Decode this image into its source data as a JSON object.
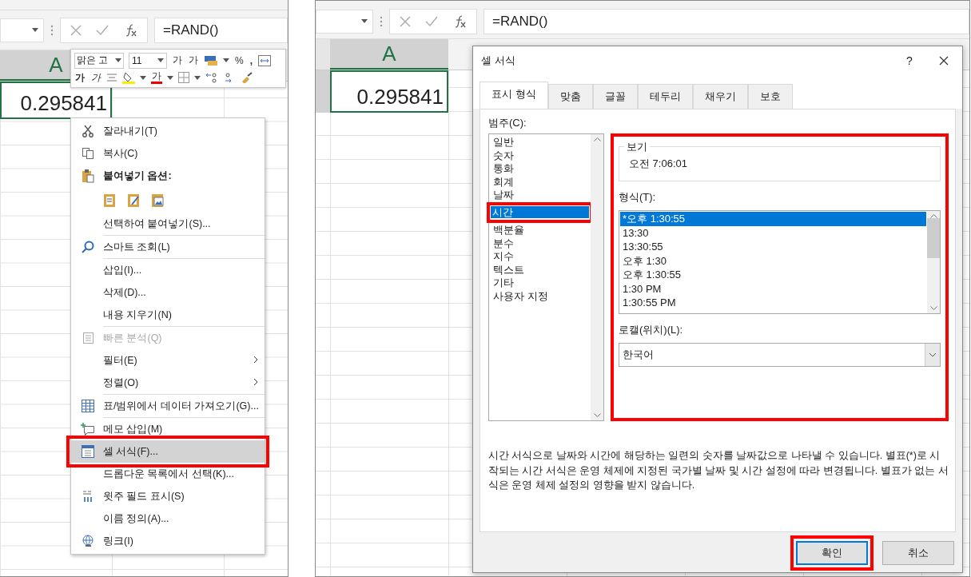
{
  "left": {
    "formula": "=RAND()",
    "column_header": "A",
    "cell_value": "0.295841",
    "mini_toolbar": {
      "font": "맑은 고",
      "size": "11",
      "grow_label": "가",
      "shrink_label": "가",
      "percent": "%",
      "comma": ",",
      "bold_label": "가",
      "italic_label": "가",
      "font_color_label": "가"
    },
    "context_menu": [
      {
        "kind": "item",
        "label": "잘라내기(T)",
        "selected": false,
        "disabled": false,
        "submenu": false,
        "highlighted": false
      },
      {
        "kind": "item",
        "label": "복사(C)",
        "selected": false,
        "disabled": false,
        "submenu": false,
        "highlighted": false
      },
      {
        "kind": "header",
        "label": "붙여넣기 옵션:",
        "selected": false,
        "disabled": false,
        "submenu": false,
        "highlighted": false
      },
      {
        "kind": "paste-options"
      },
      {
        "kind": "item",
        "label": "선택하여 붙여넣기(S)...",
        "selected": false,
        "disabled": false,
        "submenu": false,
        "highlighted": false
      },
      {
        "kind": "separator"
      },
      {
        "kind": "item",
        "label": "스마트 조회(L)",
        "selected": false,
        "disabled": false,
        "submenu": false,
        "highlighted": false
      },
      {
        "kind": "separator"
      },
      {
        "kind": "item",
        "label": "삽입(I)...",
        "selected": false,
        "disabled": false,
        "submenu": false,
        "highlighted": false
      },
      {
        "kind": "item",
        "label": "삭제(D)...",
        "selected": false,
        "disabled": false,
        "submenu": false,
        "highlighted": false
      },
      {
        "kind": "item",
        "label": "내용 지우기(N)",
        "selected": false,
        "disabled": false,
        "submenu": false,
        "highlighted": false
      },
      {
        "kind": "separator"
      },
      {
        "kind": "item",
        "label": "빠른 분석(Q)",
        "selected": false,
        "disabled": true,
        "submenu": false,
        "highlighted": false
      },
      {
        "kind": "item",
        "label": "필터(E)",
        "selected": false,
        "disabled": false,
        "submenu": true,
        "highlighted": false
      },
      {
        "kind": "item",
        "label": "정렬(O)",
        "selected": false,
        "disabled": false,
        "submenu": true,
        "highlighted": false
      },
      {
        "kind": "separator"
      },
      {
        "kind": "item",
        "label": "표/범위에서 데이터 가져오기(G)...",
        "selected": false,
        "disabled": false,
        "submenu": false,
        "highlighted": false
      },
      {
        "kind": "separator"
      },
      {
        "kind": "item",
        "label": "메모 삽입(M)",
        "selected": false,
        "disabled": false,
        "submenu": false,
        "highlighted": false
      },
      {
        "kind": "item",
        "label": "셀 서식(F)...",
        "selected": true,
        "disabled": false,
        "submenu": false,
        "highlighted": true
      },
      {
        "kind": "item",
        "label": "드롭다운 목록에서 선택(K)...",
        "selected": false,
        "disabled": false,
        "submenu": false,
        "highlighted": false
      },
      {
        "kind": "item",
        "label": "윗주 필드 표시(S)",
        "selected": false,
        "disabled": false,
        "submenu": false,
        "highlighted": false
      },
      {
        "kind": "item",
        "label": "이름 정의(A)...",
        "selected": false,
        "disabled": false,
        "submenu": false,
        "highlighted": false
      },
      {
        "kind": "item",
        "label": "링크(I)",
        "selected": false,
        "disabled": false,
        "submenu": false,
        "highlighted": false
      }
    ]
  },
  "right": {
    "formula": "=RAND()",
    "column_header": "A",
    "cell_value": "0.295841",
    "dialog": {
      "title": "셀 서식",
      "help": "?",
      "tabs": [
        {
          "label": "표시 형식",
          "selected": true
        },
        {
          "label": "맞춤",
          "selected": false
        },
        {
          "label": "글꼴",
          "selected": false
        },
        {
          "label": "테두리",
          "selected": false
        },
        {
          "label": "채우기",
          "selected": false
        },
        {
          "label": "보호",
          "selected": false
        }
      ],
      "category_label": "범주(C):",
      "categories": [
        {
          "label": "일반",
          "selected": false
        },
        {
          "label": "숫자",
          "selected": false
        },
        {
          "label": "통화",
          "selected": false
        },
        {
          "label": "회계",
          "selected": false
        },
        {
          "label": "날짜",
          "selected": false
        },
        {
          "label": "시간",
          "selected": true
        },
        {
          "label": "백분율",
          "selected": false
        },
        {
          "label": "분수",
          "selected": false
        },
        {
          "label": "지수",
          "selected": false
        },
        {
          "label": "텍스트",
          "selected": false
        },
        {
          "label": "기타",
          "selected": false
        },
        {
          "label": "사용자 지정",
          "selected": false
        }
      ],
      "selected_category_highlighted": true,
      "format_section_highlighted": true,
      "sample": {
        "legend": "보기",
        "value": "오전 7:06:01"
      },
      "format_label": "형식(T):",
      "formats": [
        {
          "label": "*오후 1:30:55",
          "selected": true
        },
        {
          "label": "13:30",
          "selected": false
        },
        {
          "label": "13:30:55",
          "selected": false
        },
        {
          "label": "오후 1:30",
          "selected": false
        },
        {
          "label": "오후 1:30:55",
          "selected": false
        },
        {
          "label": "1:30 PM",
          "selected": false
        },
        {
          "label": "1:30:55 PM",
          "selected": false
        }
      ],
      "locale_label": "로캘(위치)(L):",
      "locale": "한국어",
      "description": "시간 서식으로 날짜와 시간에 해당하는 일련의 숫자를 날짜값으로 나타낼 수 있습니다. 별표(*)로 시작되는 시간 서식은 운영 체제에 지정된 국가별 날짜 및 시간 설정에 따라 변경됩니다. 별표가 없는 서식은 운영 체제 설정의 영향을 받지 않습니다.",
      "buttons": [
        {
          "label": "확인",
          "default": true,
          "highlighted": true
        },
        {
          "label": "취소",
          "default": false,
          "highlighted": false
        }
      ]
    }
  }
}
